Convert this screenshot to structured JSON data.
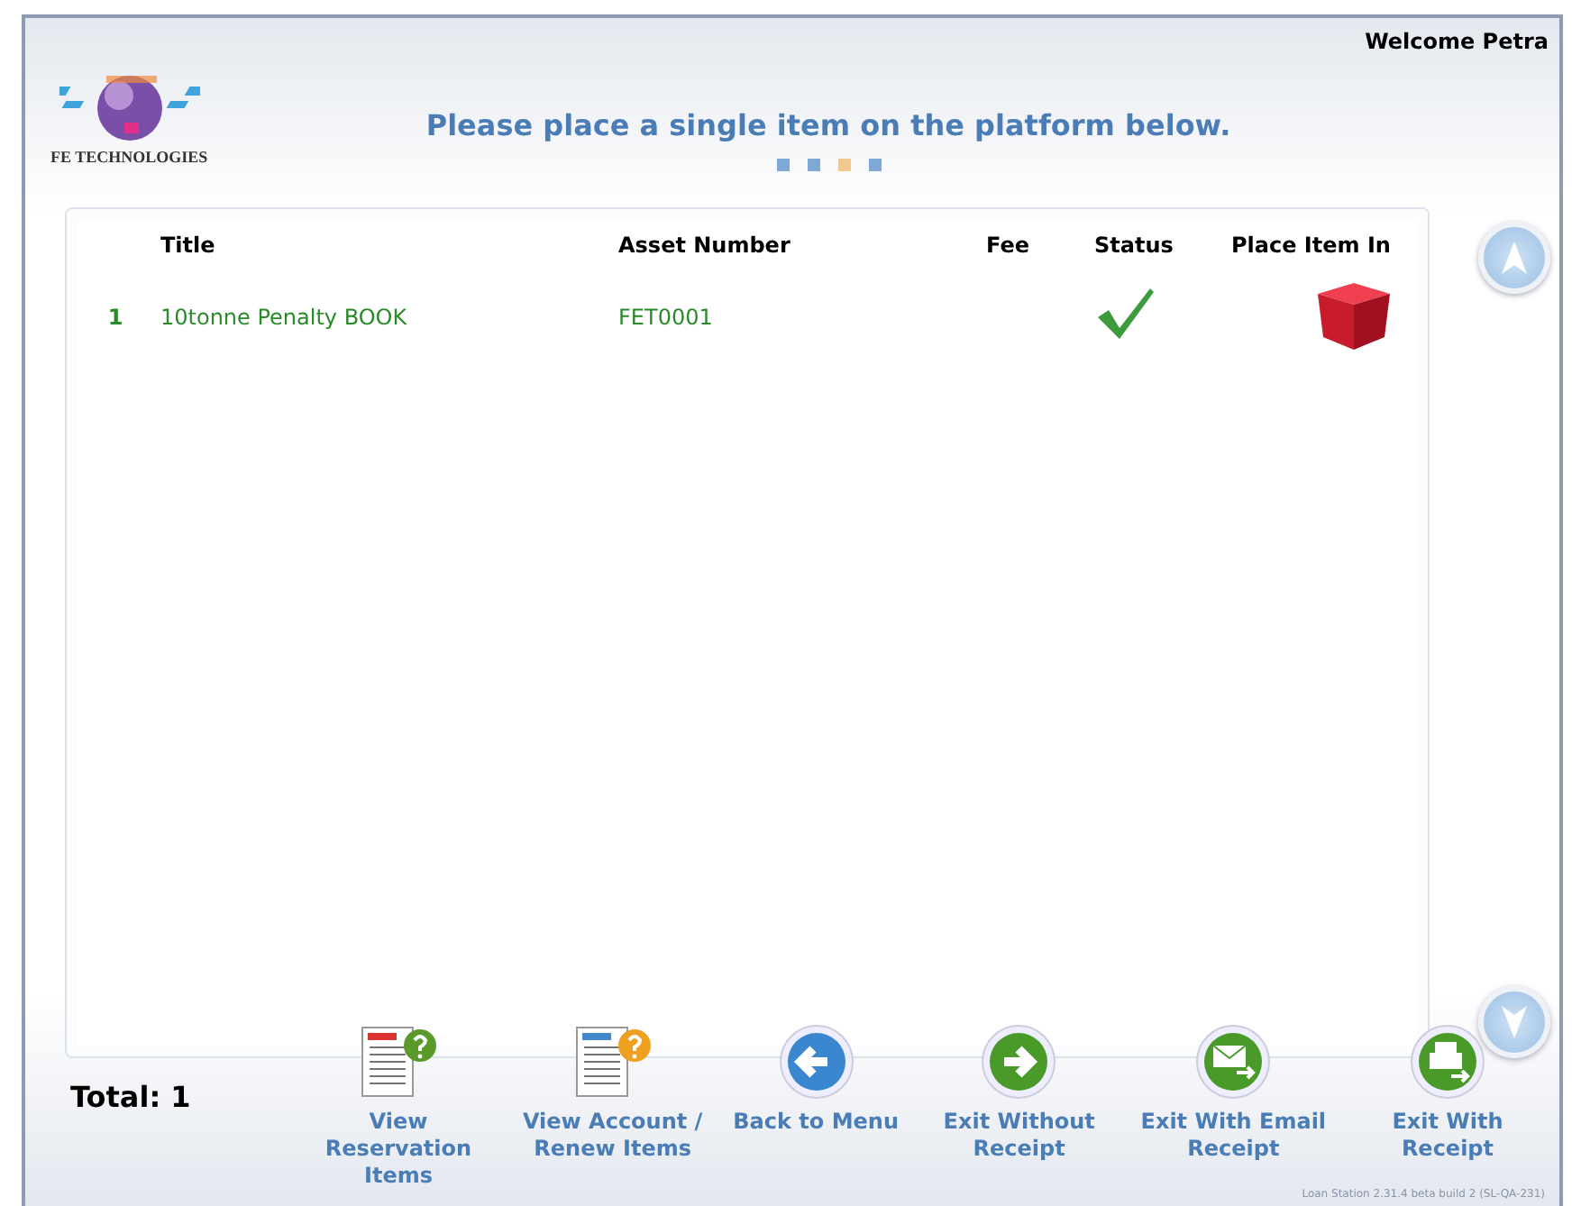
{
  "header": {
    "welcome": "Welcome Petra",
    "logo_text": "FE TECHNOLOGIES",
    "instruction": "Please place a single item on the platform below.",
    "steps": [
      {
        "selected": false
      },
      {
        "selected": false
      },
      {
        "selected": true
      },
      {
        "selected": false
      }
    ]
  },
  "table": {
    "columns": [
      "Title",
      "Asset Number",
      "Fee",
      "Status",
      "Place Item In"
    ],
    "rows": [
      {
        "number": "1",
        "title": "10tonne Penalty BOOK",
        "asset_number": "FET0001",
        "fee": "",
        "status_ok": true
      }
    ]
  },
  "total": "Total: 1",
  "actions": [
    {
      "kind": "reservation",
      "label": "View Reservation Items"
    },
    {
      "kind": "account",
      "label": "View Account / Renew Items"
    },
    {
      "kind": "back",
      "label": "Back to Menu"
    },
    {
      "kind": "exit",
      "label": "Exit Without Receipt"
    },
    {
      "kind": "email",
      "label": "Exit With Email Receipt"
    },
    {
      "kind": "print",
      "label": "Exit With Receipt"
    }
  ],
  "version": "Loan Station 2.31.4 beta build 2 (SL-QA-231)"
}
